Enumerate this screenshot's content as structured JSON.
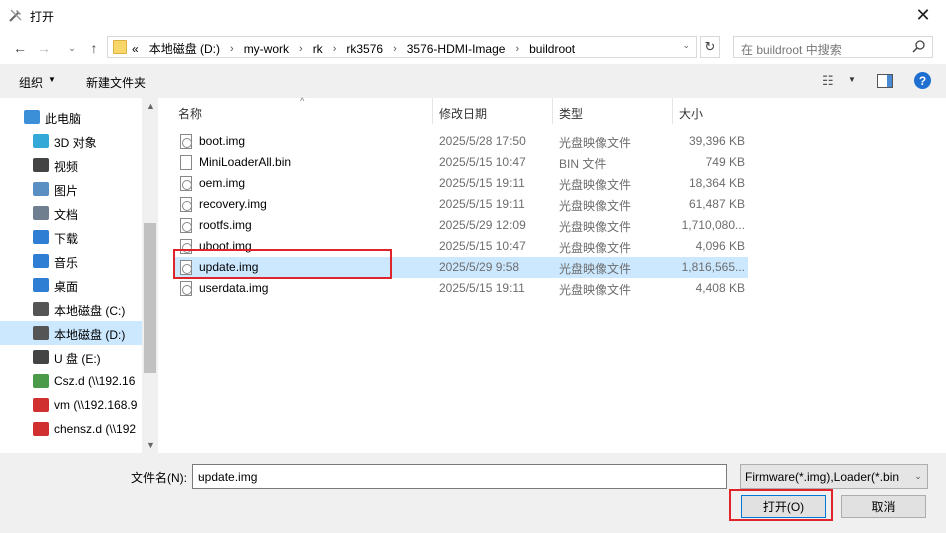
{
  "window": {
    "title": "打开",
    "close_glyph": "✕"
  },
  "nav": {
    "back_glyph": "←",
    "forward_glyph": "→",
    "recent_glyph": "⌄",
    "up_glyph": "↑",
    "breadcrumbs": [
      "«",
      "本地磁盘 (D:)",
      "my-work",
      "rk",
      "rk3576",
      "3576-HDMI-Image",
      "buildroot"
    ],
    "refresh_glyph": "↻",
    "search_placeholder": "在 buildroot 中搜索"
  },
  "toolbar": {
    "organize": "组织",
    "new_folder": "新建文件夹",
    "help": "?"
  },
  "sidebar": {
    "items": [
      {
        "label": "此电脑",
        "icon": "computer-icon",
        "level": "top"
      },
      {
        "label": "3D 对象",
        "icon": "3d-objects-icon"
      },
      {
        "label": "视频",
        "icon": "video-icon"
      },
      {
        "label": "图片",
        "icon": "pictures-icon"
      },
      {
        "label": "文档",
        "icon": "documents-icon"
      },
      {
        "label": "下载",
        "icon": "download-icon"
      },
      {
        "label": "音乐",
        "icon": "music-icon"
      },
      {
        "label": "桌面",
        "icon": "desktop-icon"
      },
      {
        "label": "本地磁盘 (C:)",
        "icon": "drive-icon"
      },
      {
        "label": "本地磁盘 (D:)",
        "icon": "drive-icon",
        "selected": true
      },
      {
        "label": "U 盘 (E:)",
        "icon": "usb-drive-icon"
      },
      {
        "label": "Csz.d (\\\\192.16",
        "icon": "network-drive-icon"
      },
      {
        "label": "vm (\\\\192.168.9",
        "icon": "network-drive-disconnected-icon"
      },
      {
        "label": "chensz.d (\\\\192",
        "icon": "network-drive-disconnected-icon"
      }
    ]
  },
  "columns": {
    "name": "名称",
    "date": "修改日期",
    "type": "类型",
    "size": "大小"
  },
  "files": [
    {
      "name": "boot.img",
      "date": "2025/5/28 17:50",
      "type": "光盘映像文件",
      "size": "39,396 KB",
      "icon": "disc-image-icon"
    },
    {
      "name": "MiniLoaderAll.bin",
      "date": "2025/5/15 10:47",
      "type": "BIN 文件",
      "size": "749 KB",
      "icon": "file-icon"
    },
    {
      "name": "oem.img",
      "date": "2025/5/15 19:11",
      "type": "光盘映像文件",
      "size": "18,364 KB",
      "icon": "disc-image-icon"
    },
    {
      "name": "recovery.img",
      "date": "2025/5/15 19:11",
      "type": "光盘映像文件",
      "size": "61,487 KB",
      "icon": "disc-image-icon"
    },
    {
      "name": "rootfs.img",
      "date": "2025/5/29 12:09",
      "type": "光盘映像文件",
      "size": "1,710,080...",
      "icon": "disc-image-icon"
    },
    {
      "name": "uboot.img",
      "date": "2025/5/15 10:47",
      "type": "光盘映像文件",
      "size": "4,096 KB",
      "icon": "disc-image-icon"
    },
    {
      "name": "update.img",
      "date": "2025/5/29 9:58",
      "type": "光盘映像文件",
      "size": "1,816,565...",
      "icon": "disc-image-icon",
      "selected": true
    },
    {
      "name": "userdata.img",
      "date": "2025/5/15 19:11",
      "type": "光盘映像文件",
      "size": "4,408 KB",
      "icon": "disc-image-icon"
    }
  ],
  "bottom": {
    "filename_label": "文件名(N):",
    "filename_value": "update.img",
    "filter": "Firmware(*.img),Loader(*.bin",
    "open_button": "打开(O)",
    "cancel_button": "取消"
  },
  "colors": {
    "selection": "#cce8ff",
    "highlight_box": "#e0242c",
    "accent": "#0078d7"
  }
}
